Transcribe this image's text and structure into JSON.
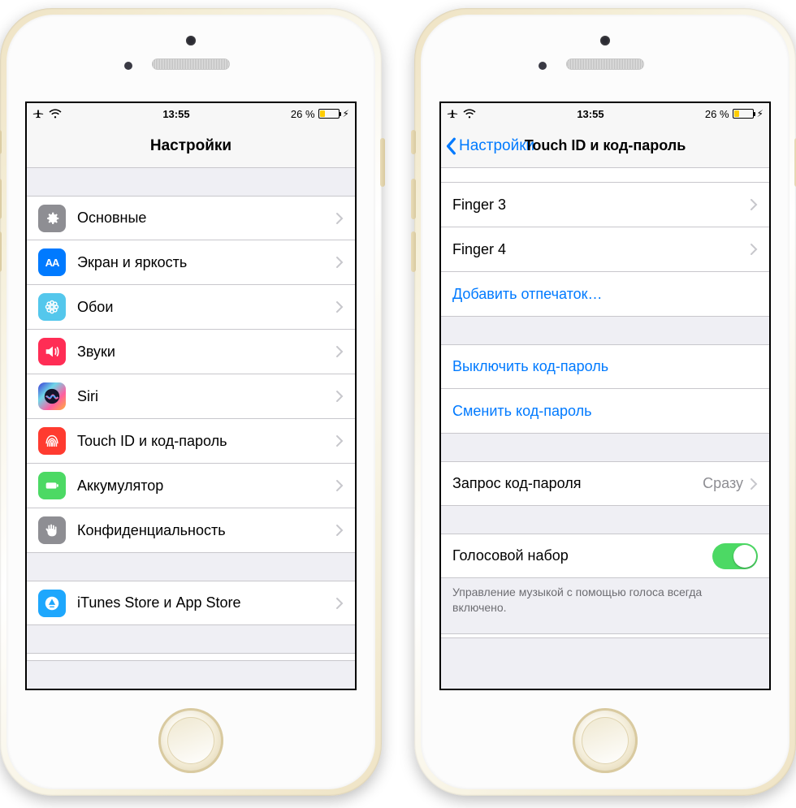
{
  "statusbar": {
    "time": "13:55",
    "battery_pct": "26 %"
  },
  "left": {
    "nav_title": "Настройки",
    "items": [
      {
        "id": "general",
        "label": "Основные",
        "icon": "gear",
        "bg": "#8e8e93"
      },
      {
        "id": "display",
        "label": "Экран и яркость",
        "icon": "aa",
        "bg": "#007aff"
      },
      {
        "id": "wallpaper",
        "label": "Обои",
        "icon": "flower",
        "bg": "#54c7ec"
      },
      {
        "id": "sounds",
        "label": "Звуки",
        "icon": "speaker",
        "bg": "#ff2d55"
      },
      {
        "id": "siri",
        "label": "Siri",
        "icon": "siri",
        "bg": "siri"
      },
      {
        "id": "touchid",
        "label": "Touch ID и код-пароль",
        "icon": "finger",
        "bg": "#ff3b30"
      },
      {
        "id": "battery",
        "label": "Аккумулятор",
        "icon": "battery",
        "bg": "#4cd964"
      },
      {
        "id": "privacy",
        "label": "Конфиденциальность",
        "icon": "hand",
        "bg": "#8e8e93"
      }
    ],
    "items2": [
      {
        "id": "itunes",
        "label": "iTunes Store и App Store",
        "icon": "appstore",
        "bg": "#1ea7fd"
      }
    ]
  },
  "right": {
    "back_label": "Настройки",
    "nav_title": "Touch ID и код-пароль",
    "fingers": [
      {
        "label": "Finger 3"
      },
      {
        "label": "Finger 4"
      }
    ],
    "add_finger": "Добавить отпечаток…",
    "actions": [
      {
        "label": "Выключить код-пароль"
      },
      {
        "label": "Сменить код-пароль"
      }
    ],
    "require": {
      "label": "Запрос код-пароля",
      "value": "Сразу"
    },
    "voice": {
      "label": "Голосовой набор",
      "on": true
    },
    "voice_footer": "Управление музыкой с помощью голоса всегда включено."
  }
}
